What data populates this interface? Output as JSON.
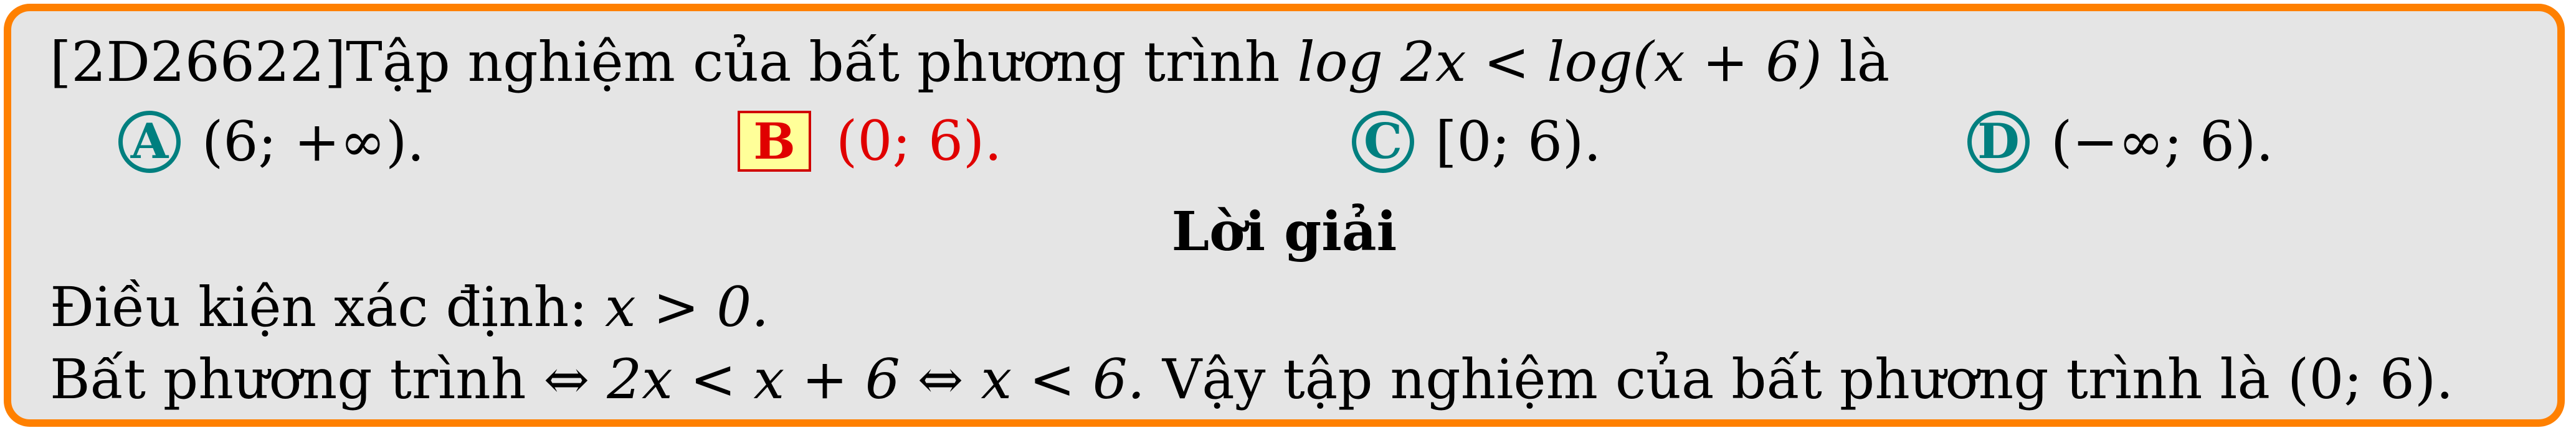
{
  "question": {
    "code": "[2D26622]",
    "text_before_math": "Tập nghiệm của bất phương trình ",
    "math": "log 2x < log(x + 6)",
    "text_after_math": " là"
  },
  "choices": [
    {
      "letter": "A",
      "text": "(6; +∞).",
      "correct": false
    },
    {
      "letter": "B",
      "text": "(0; 6).",
      "correct": true
    },
    {
      "letter": "C",
      "text": "[0; 6).",
      "correct": false
    },
    {
      "letter": "D",
      "text": "(−∞; 6).",
      "correct": false
    }
  ],
  "solution": {
    "title": "Lời giải",
    "condition_label": "Điều kiện xác định: ",
    "condition_math": "x > 0.",
    "reasoning_label": "Bất phương trình ",
    "reasoning_math": "⇔ 2x < x + 6 ⇔ x < 6.",
    "conclusion": " Vậy tập nghiệm của bất phương trình là (0; 6)."
  },
  "colors": {
    "border": "#ff8000",
    "background": "#e5e5e5",
    "choice_circle": "#007f7f",
    "correct": "#e00000",
    "correct_box_fill": "#ffff99"
  }
}
